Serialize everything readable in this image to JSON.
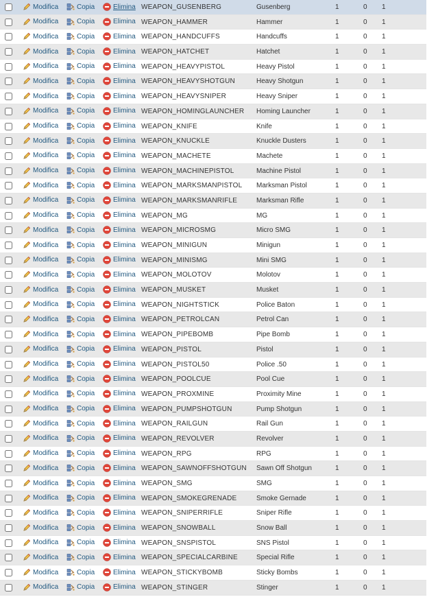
{
  "actions": {
    "edit": "Modifica",
    "copy": "Copia",
    "delete": "Elimina"
  },
  "colors": {
    "odd_row": "#ffffff",
    "even_row": "#e8e8e8",
    "hover_row": "#d0dbe8",
    "link": "#235a81"
  },
  "icons": {
    "edit": "pencil-icon",
    "copy": "copy-icon",
    "delete": "delete-icon"
  },
  "rows": [
    {
      "name": "WEAPON_GUSENBERG",
      "label": "Gusenberg",
      "c1": "1",
      "c2": "0",
      "c3": "1"
    },
    {
      "name": "WEAPON_HAMMER",
      "label": "Hammer",
      "c1": "1",
      "c2": "0",
      "c3": "1"
    },
    {
      "name": "WEAPON_HANDCUFFS",
      "label": "Handcuffs",
      "c1": "1",
      "c2": "0",
      "c3": "1"
    },
    {
      "name": "WEAPON_HATCHET",
      "label": "Hatchet",
      "c1": "1",
      "c2": "0",
      "c3": "1"
    },
    {
      "name": "WEAPON_HEAVYPISTOL",
      "label": "Heavy Pistol",
      "c1": "1",
      "c2": "0",
      "c3": "1"
    },
    {
      "name": "WEAPON_HEAVYSHOTGUN",
      "label": "Heavy Shotgun",
      "c1": "1",
      "c2": "0",
      "c3": "1"
    },
    {
      "name": "WEAPON_HEAVYSNIPER",
      "label": "Heavy Sniper",
      "c1": "1",
      "c2": "0",
      "c3": "1"
    },
    {
      "name": "WEAPON_HOMINGLAUNCHER",
      "label": "Homing Launcher",
      "c1": "1",
      "c2": "0",
      "c3": "1"
    },
    {
      "name": "WEAPON_KNIFE",
      "label": "Knife",
      "c1": "1",
      "c2": "0",
      "c3": "1"
    },
    {
      "name": "WEAPON_KNUCKLE",
      "label": "Knuckle Dusters",
      "c1": "1",
      "c2": "0",
      "c3": "1"
    },
    {
      "name": "WEAPON_MACHETE",
      "label": "Machete",
      "c1": "1",
      "c2": "0",
      "c3": "1"
    },
    {
      "name": "WEAPON_MACHINEPISTOL",
      "label": "Machine Pistol",
      "c1": "1",
      "c2": "0",
      "c3": "1"
    },
    {
      "name": "WEAPON_MARKSMANPISTOL",
      "label": "Marksman Pistol",
      "c1": "1",
      "c2": "0",
      "c3": "1"
    },
    {
      "name": "WEAPON_MARKSMANRIFLE",
      "label": "Marksman Rifle",
      "c1": "1",
      "c2": "0",
      "c3": "1"
    },
    {
      "name": "WEAPON_MG",
      "label": "MG",
      "c1": "1",
      "c2": "0",
      "c3": "1"
    },
    {
      "name": "WEAPON_MICROSMG",
      "label": "Micro SMG",
      "c1": "1",
      "c2": "0",
      "c3": "1"
    },
    {
      "name": "WEAPON_MINIGUN",
      "label": "Minigun",
      "c1": "1",
      "c2": "0",
      "c3": "1"
    },
    {
      "name": "WEAPON_MINISMG",
      "label": "Mini SMG",
      "c1": "1",
      "c2": "0",
      "c3": "1"
    },
    {
      "name": "WEAPON_MOLOTOV",
      "label": "Molotov",
      "c1": "1",
      "c2": "0",
      "c3": "1"
    },
    {
      "name": "WEAPON_MUSKET",
      "label": "Musket",
      "c1": "1",
      "c2": "0",
      "c3": "1"
    },
    {
      "name": "WEAPON_NIGHTSTICK",
      "label": "Police Baton",
      "c1": "1",
      "c2": "0",
      "c3": "1"
    },
    {
      "name": "WEAPON_PETROLCAN",
      "label": "Petrol Can",
      "c1": "1",
      "c2": "0",
      "c3": "1"
    },
    {
      "name": "WEAPON_PIPEBOMB",
      "label": "Pipe Bomb",
      "c1": "1",
      "c2": "0",
      "c3": "1"
    },
    {
      "name": "WEAPON_PISTOL",
      "label": "Pistol",
      "c1": "1",
      "c2": "0",
      "c3": "1"
    },
    {
      "name": "WEAPON_PISTOL50",
      "label": "Police .50",
      "c1": "1",
      "c2": "0",
      "c3": "1"
    },
    {
      "name": "WEAPON_POOLCUE",
      "label": "Pool Cue",
      "c1": "1",
      "c2": "0",
      "c3": "1"
    },
    {
      "name": "WEAPON_PROXMINE",
      "label": "Proximity Mine",
      "c1": "1",
      "c2": "0",
      "c3": "1"
    },
    {
      "name": "WEAPON_PUMPSHOTGUN",
      "label": "Pump Shotgun",
      "c1": "1",
      "c2": "0",
      "c3": "1"
    },
    {
      "name": "WEAPON_RAILGUN",
      "label": "Rail Gun",
      "c1": "1",
      "c2": "0",
      "c3": "1"
    },
    {
      "name": "WEAPON_REVOLVER",
      "label": "Revolver",
      "c1": "1",
      "c2": "0",
      "c3": "1"
    },
    {
      "name": "WEAPON_RPG",
      "label": "RPG",
      "c1": "1",
      "c2": "0",
      "c3": "1"
    },
    {
      "name": "WEAPON_SAWNOFFSHOTGUN",
      "label": "Sawn Off Shotgun",
      "c1": "1",
      "c2": "0",
      "c3": "1"
    },
    {
      "name": "WEAPON_SMG",
      "label": "SMG",
      "c1": "1",
      "c2": "0",
      "c3": "1"
    },
    {
      "name": "WEAPON_SMOKEGRENADE",
      "label": "Smoke Gernade",
      "c1": "1",
      "c2": "0",
      "c3": "1"
    },
    {
      "name": "WEAPON_SNIPERRIFLE",
      "label": "Sniper Rifle",
      "c1": "1",
      "c2": "0",
      "c3": "1"
    },
    {
      "name": "WEAPON_SNOWBALL",
      "label": "Snow Ball",
      "c1": "1",
      "c2": "0",
      "c3": "1"
    },
    {
      "name": "WEAPON_SNSPISTOL",
      "label": "SNS Pistol",
      "c1": "1",
      "c2": "0",
      "c3": "1"
    },
    {
      "name": "WEAPON_SPECIALCARBINE",
      "label": "Special Rifle",
      "c1": "1",
      "c2": "0",
      "c3": "1"
    },
    {
      "name": "WEAPON_STICKYBOMB",
      "label": "Sticky Bombs",
      "c1": "1",
      "c2": "0",
      "c3": "1"
    },
    {
      "name": "WEAPON_STINGER",
      "label": "Stinger",
      "c1": "1",
      "c2": "0",
      "c3": "1"
    }
  ]
}
